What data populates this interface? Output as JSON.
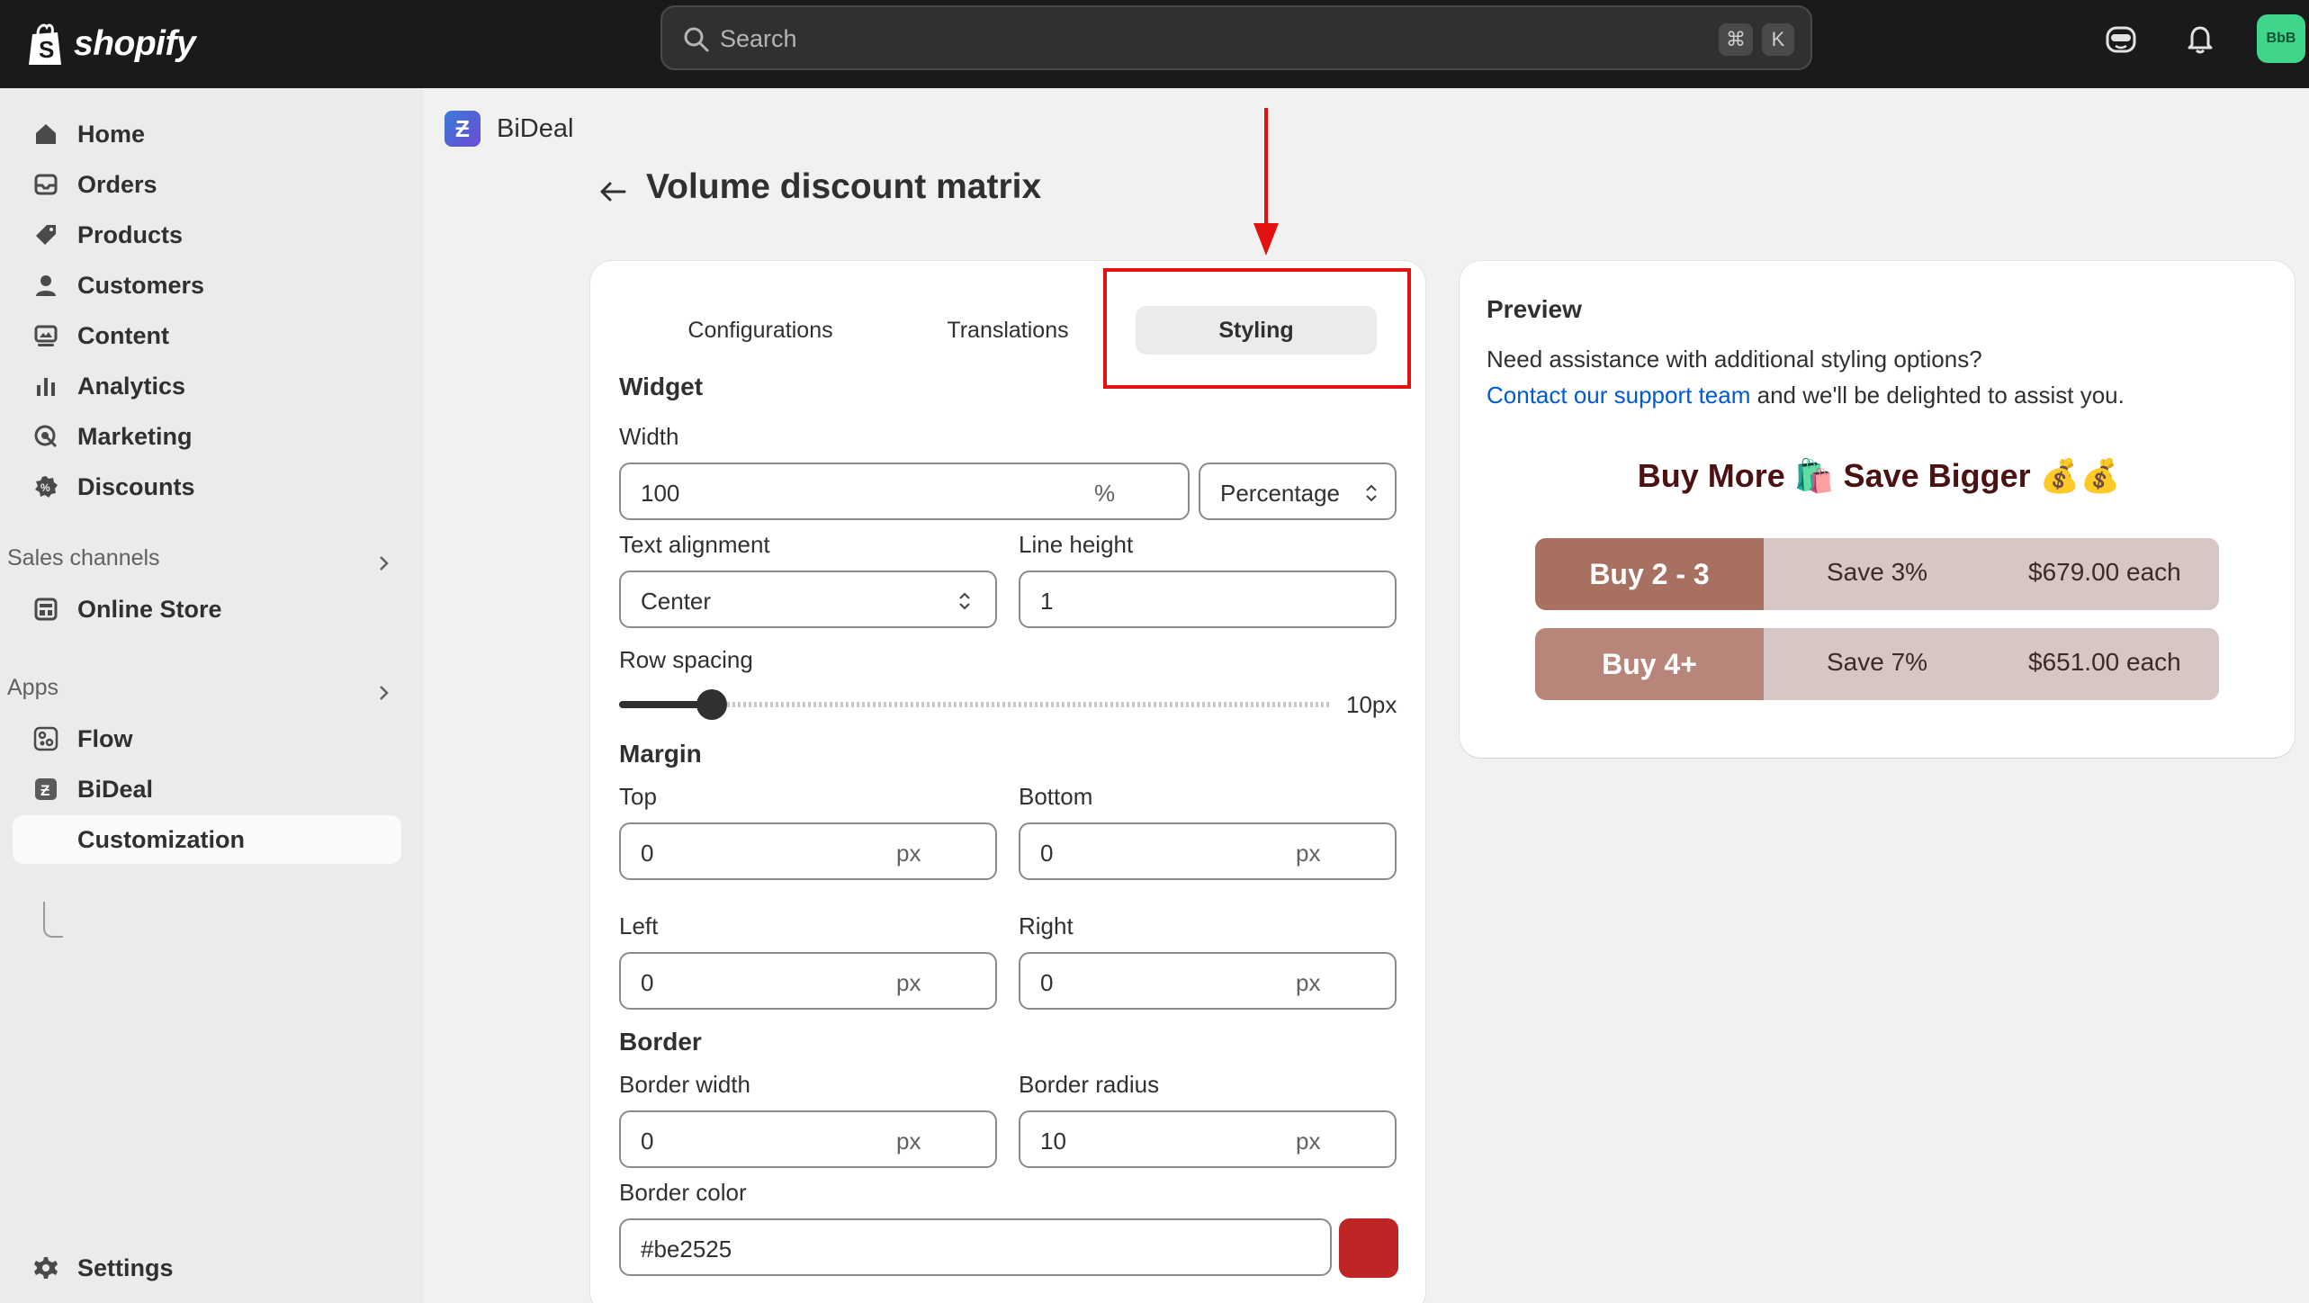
{
  "topbar": {
    "brand": "shopify",
    "search_placeholder": "Search",
    "shortcut_key1": "⌘",
    "shortcut_key2": "K",
    "avatar_initials": "BbB"
  },
  "sidebar": {
    "items": [
      {
        "label": "Home",
        "icon": "home-icon"
      },
      {
        "label": "Orders",
        "icon": "orders-icon"
      },
      {
        "label": "Products",
        "icon": "tag-icon"
      },
      {
        "label": "Customers",
        "icon": "person-icon"
      },
      {
        "label": "Content",
        "icon": "content-icon"
      },
      {
        "label": "Analytics",
        "icon": "bar-chart-icon"
      },
      {
        "label": "Marketing",
        "icon": "target-icon"
      },
      {
        "label": "Discounts",
        "icon": "discount-icon"
      }
    ],
    "sales_channels_heading": "Sales channels",
    "online_store": "Online Store",
    "apps_heading": "Apps",
    "flow": "Flow",
    "bideal": "BiDeal",
    "customization": "Customization",
    "settings": "Settings"
  },
  "app": {
    "logo_letter": "Ƶ",
    "name": "BiDeal"
  },
  "page": {
    "title": "Volume discount matrix"
  },
  "tabs": {
    "configurations": "Configurations",
    "translations": "Translations",
    "styling": "Styling",
    "active": "Styling"
  },
  "form": {
    "widget_heading": "Widget",
    "width_label": "Width",
    "width_value": "100",
    "width_suffix": "%",
    "width_unit": "Percentage",
    "text_alignment_label": "Text alignment",
    "text_alignment_value": "Center",
    "line_height_label": "Line height",
    "line_height_value": "1",
    "row_spacing_label": "Row spacing",
    "row_spacing_value": "10px",
    "row_spacing_fraction": 0.13,
    "margin_heading": "Margin",
    "top_label": "Top",
    "top_value": "0",
    "bottom_label": "Bottom",
    "bottom_value": "0",
    "left_label": "Left",
    "left_value": "0",
    "right_label": "Right",
    "right_value": "0",
    "px": "px",
    "border_heading": "Border",
    "border_width_label": "Border width",
    "border_width_value": "0",
    "border_radius_label": "Border radius",
    "border_radius_value": "10",
    "border_color_label": "Border color",
    "border_color_value": "#be2525"
  },
  "preview": {
    "title": "Preview",
    "assist_text": "Need assistance with additional styling options?",
    "link_text": "Contact our support team",
    "link_after": " and we'll be delighted to assist you.",
    "headline": "Buy More 🛍️ Save Bigger 💰💰",
    "rows": [
      {
        "buy": "Buy 2 - 3",
        "save": "Save 3%",
        "price": "$679.00 each",
        "color": "#a87060"
      },
      {
        "buy": "Buy 4+",
        "save": "Save 7%",
        "price": "$651.00 each",
        "color": "#b7857a"
      }
    ]
  },
  "colors": {
    "annotation_red": "#e3110f",
    "link_blue": "#005bd3",
    "swatch": "#be2525"
  }
}
